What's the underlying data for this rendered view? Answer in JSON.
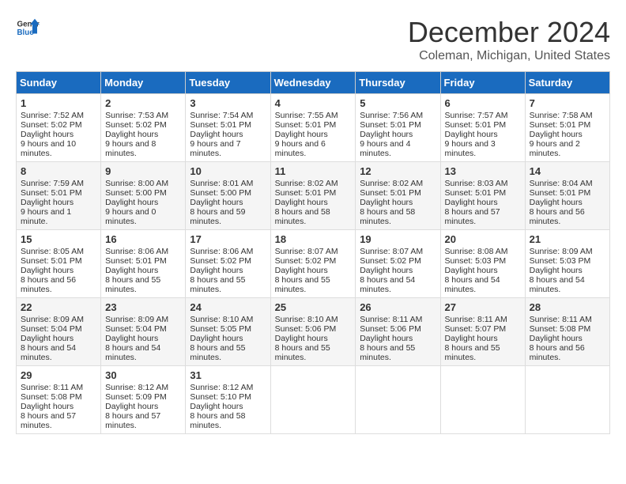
{
  "header": {
    "logo_general": "General",
    "logo_blue": "Blue",
    "month": "December 2024",
    "location": "Coleman, Michigan, United States"
  },
  "weekdays": [
    "Sunday",
    "Monday",
    "Tuesday",
    "Wednesday",
    "Thursday",
    "Friday",
    "Saturday"
  ],
  "weeks": [
    [
      {
        "day": "1",
        "sunrise": "7:52 AM",
        "sunset": "5:02 PM",
        "daylight": "9 hours and 10 minutes."
      },
      {
        "day": "2",
        "sunrise": "7:53 AM",
        "sunset": "5:02 PM",
        "daylight": "9 hours and 8 minutes."
      },
      {
        "day": "3",
        "sunrise": "7:54 AM",
        "sunset": "5:01 PM",
        "daylight": "9 hours and 7 minutes."
      },
      {
        "day": "4",
        "sunrise": "7:55 AM",
        "sunset": "5:01 PM",
        "daylight": "9 hours and 6 minutes."
      },
      {
        "day": "5",
        "sunrise": "7:56 AM",
        "sunset": "5:01 PM",
        "daylight": "9 hours and 4 minutes."
      },
      {
        "day": "6",
        "sunrise": "7:57 AM",
        "sunset": "5:01 PM",
        "daylight": "9 hours and 3 minutes."
      },
      {
        "day": "7",
        "sunrise": "7:58 AM",
        "sunset": "5:01 PM",
        "daylight": "9 hours and 2 minutes."
      }
    ],
    [
      {
        "day": "8",
        "sunrise": "7:59 AM",
        "sunset": "5:01 PM",
        "daylight": "9 hours and 1 minute."
      },
      {
        "day": "9",
        "sunrise": "8:00 AM",
        "sunset": "5:00 PM",
        "daylight": "9 hours and 0 minutes."
      },
      {
        "day": "10",
        "sunrise": "8:01 AM",
        "sunset": "5:00 PM",
        "daylight": "8 hours and 59 minutes."
      },
      {
        "day": "11",
        "sunrise": "8:02 AM",
        "sunset": "5:01 PM",
        "daylight": "8 hours and 58 minutes."
      },
      {
        "day": "12",
        "sunrise": "8:02 AM",
        "sunset": "5:01 PM",
        "daylight": "8 hours and 58 minutes."
      },
      {
        "day": "13",
        "sunrise": "8:03 AM",
        "sunset": "5:01 PM",
        "daylight": "8 hours and 57 minutes."
      },
      {
        "day": "14",
        "sunrise": "8:04 AM",
        "sunset": "5:01 PM",
        "daylight": "8 hours and 56 minutes."
      }
    ],
    [
      {
        "day": "15",
        "sunrise": "8:05 AM",
        "sunset": "5:01 PM",
        "daylight": "8 hours and 56 minutes."
      },
      {
        "day": "16",
        "sunrise": "8:06 AM",
        "sunset": "5:01 PM",
        "daylight": "8 hours and 55 minutes."
      },
      {
        "day": "17",
        "sunrise": "8:06 AM",
        "sunset": "5:02 PM",
        "daylight": "8 hours and 55 minutes."
      },
      {
        "day": "18",
        "sunrise": "8:07 AM",
        "sunset": "5:02 PM",
        "daylight": "8 hours and 55 minutes."
      },
      {
        "day": "19",
        "sunrise": "8:07 AM",
        "sunset": "5:02 PM",
        "daylight": "8 hours and 54 minutes."
      },
      {
        "day": "20",
        "sunrise": "8:08 AM",
        "sunset": "5:03 PM",
        "daylight": "8 hours and 54 minutes."
      },
      {
        "day": "21",
        "sunrise": "8:09 AM",
        "sunset": "5:03 PM",
        "daylight": "8 hours and 54 minutes."
      }
    ],
    [
      {
        "day": "22",
        "sunrise": "8:09 AM",
        "sunset": "5:04 PM",
        "daylight": "8 hours and 54 minutes."
      },
      {
        "day": "23",
        "sunrise": "8:09 AM",
        "sunset": "5:04 PM",
        "daylight": "8 hours and 54 minutes."
      },
      {
        "day": "24",
        "sunrise": "8:10 AM",
        "sunset": "5:05 PM",
        "daylight": "8 hours and 55 minutes."
      },
      {
        "day": "25",
        "sunrise": "8:10 AM",
        "sunset": "5:06 PM",
        "daylight": "8 hours and 55 minutes."
      },
      {
        "day": "26",
        "sunrise": "8:11 AM",
        "sunset": "5:06 PM",
        "daylight": "8 hours and 55 minutes."
      },
      {
        "day": "27",
        "sunrise": "8:11 AM",
        "sunset": "5:07 PM",
        "daylight": "8 hours and 55 minutes."
      },
      {
        "day": "28",
        "sunrise": "8:11 AM",
        "sunset": "5:08 PM",
        "daylight": "8 hours and 56 minutes."
      }
    ],
    [
      {
        "day": "29",
        "sunrise": "8:11 AM",
        "sunset": "5:08 PM",
        "daylight": "8 hours and 57 minutes."
      },
      {
        "day": "30",
        "sunrise": "8:12 AM",
        "sunset": "5:09 PM",
        "daylight": "8 hours and 57 minutes."
      },
      {
        "day": "31",
        "sunrise": "8:12 AM",
        "sunset": "5:10 PM",
        "daylight": "8 hours and 58 minutes."
      },
      null,
      null,
      null,
      null
    ]
  ]
}
